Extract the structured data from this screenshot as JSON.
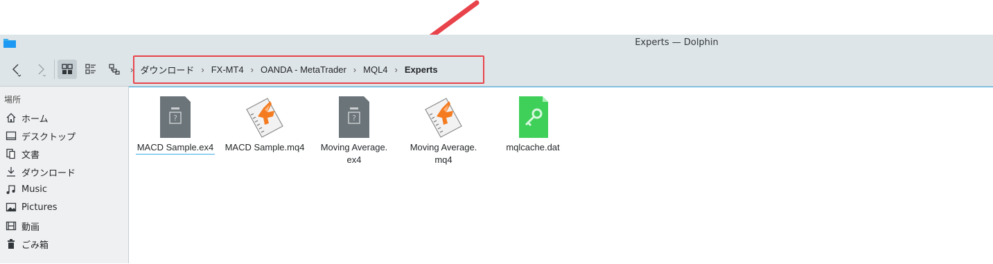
{
  "window": {
    "title": "Experts — Dolphin"
  },
  "toolbar": {
    "back_icon": "back-arrow-icon",
    "forward_icon": "forward-arrow-icon",
    "view_modes": [
      "icons-view-icon",
      "compact-view-icon",
      "details-view-icon"
    ]
  },
  "breadcrumb": {
    "items": [
      "ダウンロード",
      "FX-MT4",
      "OANDA - MetaTrader",
      "MQL4",
      "Experts"
    ]
  },
  "sidebar": {
    "heading": "場所",
    "items": [
      {
        "label": "ホーム",
        "icon": "home-icon"
      },
      {
        "label": "デスクトップ",
        "icon": "desktop-icon"
      },
      {
        "label": "文書",
        "icon": "documents-icon"
      },
      {
        "label": "ダウンロード",
        "icon": "download-icon"
      },
      {
        "label": "Music",
        "icon": "music-icon"
      },
      {
        "label": "Pictures",
        "icon": "pictures-icon"
      },
      {
        "label": "動画",
        "icon": "video-icon"
      },
      {
        "label": "ごみ箱",
        "icon": "trash-icon"
      }
    ]
  },
  "files": [
    {
      "name": "MACD Sample.ex4",
      "icon": "unknown-file-icon",
      "selected": true
    },
    {
      "name": "MACD Sample.mq4",
      "icon": "mq4-file-icon"
    },
    {
      "name": "Moving Average.\nex4",
      "name_line1": "Moving Average.",
      "name_line2": "ex4",
      "icon": "unknown-file-icon"
    },
    {
      "name": "Moving Average.\nmq4",
      "name_line1": "Moving Average.",
      "name_line2": "mq4",
      "icon": "mq4-file-icon"
    },
    {
      "name": "mqlcache.dat",
      "icon": "key-file-icon"
    }
  ],
  "colors": {
    "accent": "#3daee9",
    "annotation": "#e8434a",
    "chrome": "#dee5e8"
  }
}
